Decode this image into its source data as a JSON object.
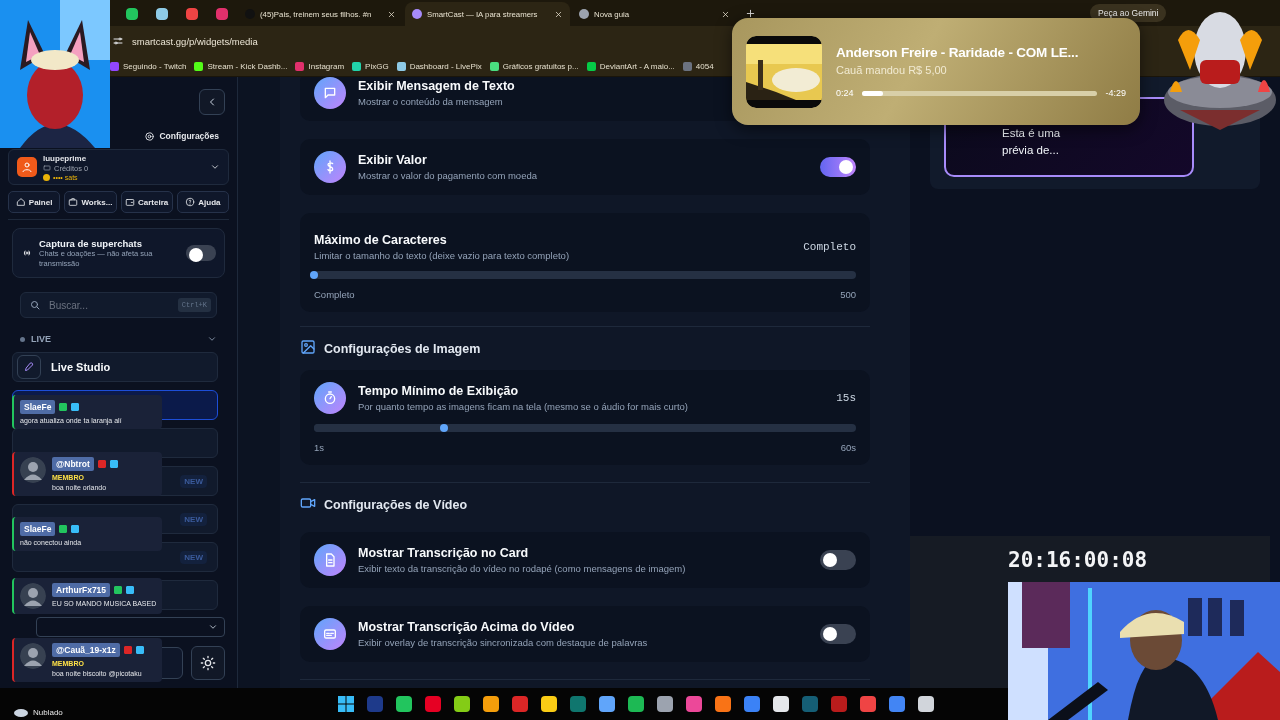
{
  "browser": {
    "tabs": [
      {
        "title": "(45)Pais, treinem seus filhos. #n",
        "selected": false
      },
      {
        "title": "SmartCast — IA para streamers",
        "selected": true
      },
      {
        "title": "Nova guia",
        "selected": false
      }
    ],
    "gemini_button": "Peça ao Gemini",
    "address": "smartcast.gg/p/widgets/media",
    "bookmarks": [
      "Seguindo - Twitch",
      "Stream - Kick Dashb...",
      "Instagram",
      "PixGG",
      "Dashboard - LivePix",
      "Gráficos gratuitos p...",
      "DeviantArt - A maio...",
      "4054"
    ]
  },
  "sidebar": {
    "settings_link": "Configurações",
    "user": {
      "name": "luupeprime",
      "credits": "Créditos 0",
      "sats": "•••• sats"
    },
    "quick_buttons": [
      "Painel",
      "Works...",
      "Carteira",
      "Ajuda"
    ],
    "superchat": {
      "title": "Captura de superchats",
      "description": "Chats e doações — não afeta sua transmissão",
      "on": false
    },
    "search": {
      "placeholder": "Buscar...",
      "shortcut": "Ctrl+K"
    },
    "section": {
      "label": "LIVE",
      "expanded": true
    },
    "live_studio": "Live Studio",
    "nav_items": [
      {
        "selected": true
      },
      {
        "selected": false
      },
      {
        "selected": false,
        "badge": "NEW"
      },
      {
        "selected": false,
        "badge": "NEW"
      },
      {
        "selected": false,
        "badge": "NEW"
      },
      {
        "selected": false
      }
    ]
  },
  "main": {
    "blocks": [
      {
        "kind": "toggle",
        "title": "Exibir Mensagem de Texto",
        "description": "Mostrar o conteúdo da mensagem"
      },
      {
        "kind": "toggle",
        "title": "Exibir Valor",
        "description": "Mostrar o valor do pagamento com moeda",
        "on": true
      },
      {
        "kind": "slider",
        "title": "Máximo de Caracteres",
        "description": "Limitar o tamanho do texto (deixe vazio para texto completo)",
        "value": "Completo",
        "level": 0,
        "min_label": "Completo",
        "max_label": "500"
      },
      {
        "kind": "heading",
        "title": "Configurações de Imagem"
      },
      {
        "kind": "slider",
        "title": "Tempo Mínimo de Exibição",
        "description": "Por quanto tempo as imagens ficam na tela (mesmo se o áudio for mais curto)",
        "value": "15s",
        "level": 0.24,
        "min_label": "1s",
        "max_label": "60s"
      },
      {
        "kind": "heading",
        "title": "Configurações de Vídeo"
      },
      {
        "kind": "toggle",
        "title": "Mostrar Transcrição no Card",
        "description": "Exibir texto da transcrição do vídeo no rodapé (como mensagens de imagem)",
        "on": false
      },
      {
        "kind": "toggle",
        "title": "Mostrar Transcrição Acima do Vídeo",
        "description": "Exibir overlay de transcrição sincronizada com destaque de palavras",
        "on": false
      }
    ]
  },
  "preview": {
    "text": "Esta é uma prévia de..."
  },
  "overlays": {
    "music": {
      "title": "Anderson Freire - Raridade - COM LE...",
      "subtitle": "Cauã mandou R$ 5,00",
      "elapsed": "0:24",
      "remaining": "-4:29",
      "level": 0.09
    },
    "timer": "20:16:00:08",
    "chat": [
      {
        "name": "SlaeFe",
        "color": "#22c55e",
        "avatar": false,
        "text": "agora atualiza onde ta laranja alí"
      },
      {
        "name": "@Nbtrot",
        "color": "#dc2626",
        "avatar": true,
        "badge": "MEMBRO",
        "text": "boa noite orlando"
      },
      {
        "name": "SlaeFe",
        "color": "#22c55e",
        "avatar": false,
        "text": "não conectou ainda"
      },
      {
        "name": "ArthurFx715",
        "color": "#22c55e",
        "avatar": true,
        "text": "EU SO MANDO MUSICA BASED"
      },
      {
        "name": "@Cauã_19-x1z",
        "color": "#dc2626",
        "avatar": true,
        "badge": "MEMBRO",
        "text": "boa noite biscoito @picotaku"
      }
    ]
  },
  "taskbar": {
    "weather": "Nublado"
  }
}
